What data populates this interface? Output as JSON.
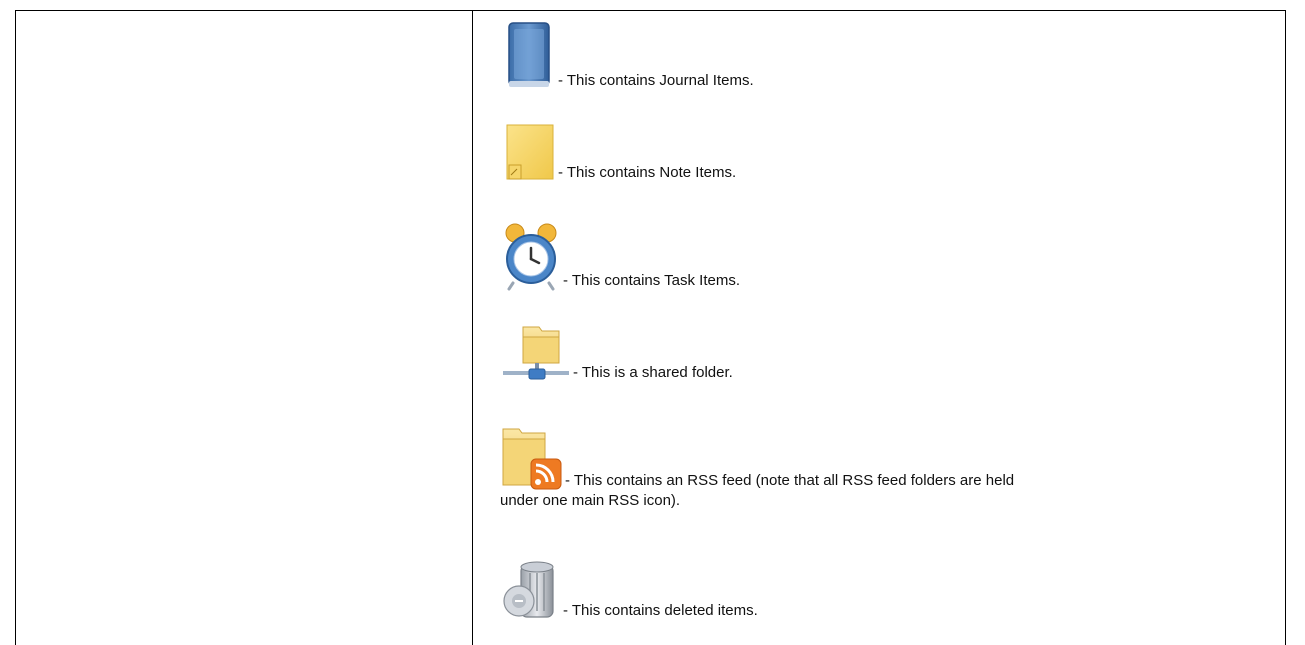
{
  "entries": [
    {
      "icon": "journal-book-icon",
      "text": "- This contains Journal Items."
    },
    {
      "icon": "sticky-note-icon",
      "text": "- This contains Note Items."
    },
    {
      "icon": "alarm-clock-icon",
      "text": "- This contains Task Items."
    },
    {
      "icon": "shared-folder-icon",
      "text": "- This is a shared folder."
    },
    {
      "icon": "rss-folder-icon",
      "text": "- This contains an RSS feed (note that all RSS feed folders are held",
      "text_cont": "under one main RSS icon)."
    },
    {
      "icon": "trash-can-icon",
      "text": "- This contains deleted items."
    }
  ]
}
